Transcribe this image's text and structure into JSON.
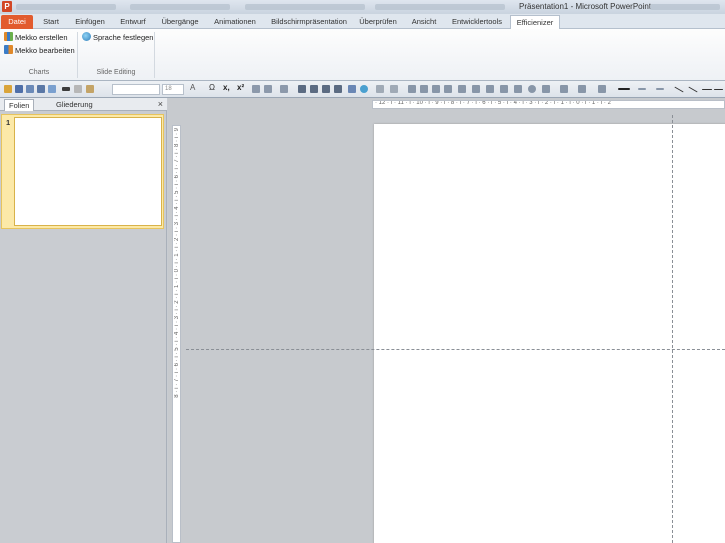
{
  "window": {
    "title": "Präsentation1 - Microsoft PowerPoint",
    "app_icon": "P"
  },
  "tabs": [
    {
      "label": "Datei"
    },
    {
      "label": "Start"
    },
    {
      "label": "Einfügen"
    },
    {
      "label": "Entwurf"
    },
    {
      "label": "Übergänge"
    },
    {
      "label": "Animationen"
    },
    {
      "label": "Bildschirmpräsentation"
    },
    {
      "label": "Überprüfen"
    },
    {
      "label": "Ansicht"
    },
    {
      "label": "Entwicklertools"
    },
    {
      "label": "Efficienizer"
    }
  ],
  "ribbon": {
    "charts_group": {
      "label": "Charts",
      "mekko_create": "Mekko erstellen",
      "mekko_edit": "Mekko bearbeiten"
    },
    "slide_editing_group": {
      "label": "Slide Editing",
      "set_language": "Sprache festlegen"
    }
  },
  "toolbar": {
    "font_size": "18",
    "symbols": {
      "sigma": "Ω",
      "sub": "x,",
      "sup": "x²"
    }
  },
  "left_pane": {
    "tab_slides": "Folien",
    "tab_outline": "Gliederung",
    "close": "×",
    "slide_number": "1"
  },
  "ruler": {
    "horizontal": "· 12 · ı · 11 · ı · 10 · ı · 9 · ı · 8 · ı · 7 · ı · 6 · ı · 5 · ı · 4 · ı · 3 · ı · 2 · ı · 1 · ı · 0 · ı · 1 · ı · 2",
    "vertical": "8 · ı · 7 · ı · 6 · ı · 5 · ı · 4 · ı · 3 · ı · 2 · ı · 1 · ı · 0 · ı · 1 · ı · 2 · ı · 3 · ı · 4 · ı · 5 · ı · 6 · ı · 7 · ı · 8 · ı · 9"
  }
}
